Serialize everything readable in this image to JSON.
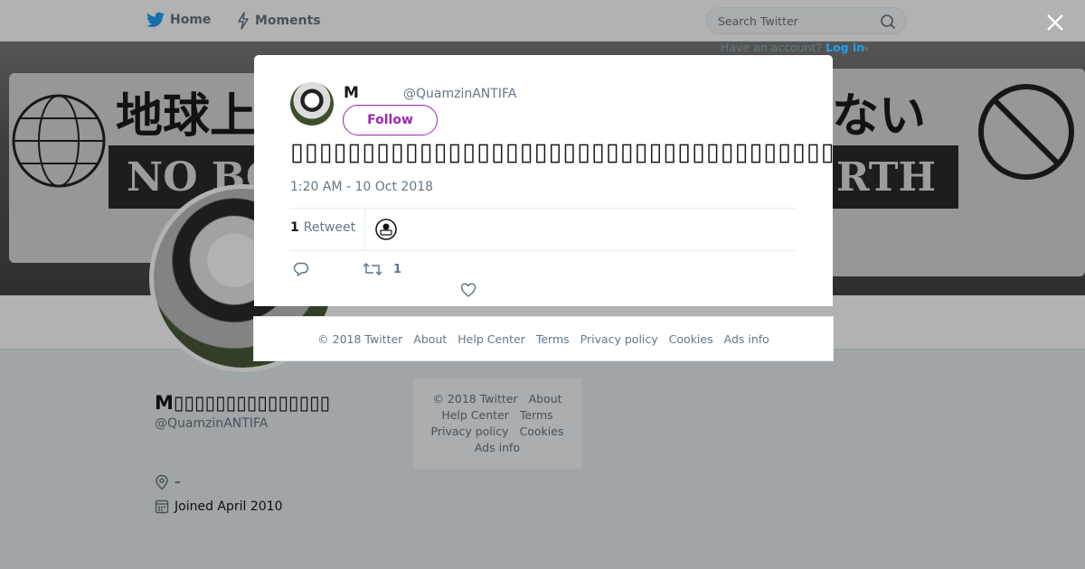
{
  "topbar": {
    "home_label": "Home",
    "moments_label": "Moments",
    "search_placeholder": "Search Twitter",
    "have_account": "Have an account?",
    "login_label": "Log in",
    "login_caret": "▾"
  },
  "banner": {
    "left_text": "地球上",
    "left_sub": "NO BO",
    "right_text": "ない",
    "right_sub": "RTH"
  },
  "profile": {
    "name": "M▯▯▯▯▯▯▯▯▯▯▯▯▯▯▯",
    "handle": "@QuamzinANTIFA",
    "location": "–",
    "joined": "Joined April 2010"
  },
  "side_footer": {
    "copyright": "© 2018 Twitter",
    "links": [
      "About",
      "Help Center",
      "Terms",
      "Privacy policy",
      "Cookies",
      "Ads info"
    ]
  },
  "tweet": {
    "author_name": "M",
    "author_handle": "@QuamzinANTIFA",
    "follow_label": "Follow",
    "text": "▯▯▯▯▯▯▯▯▯▯▯▯▯▯▯▯▯▯▯▯▯▯▯▯▯▯▯▯▯▯▯▯▯▯▯▯▯▯▯▯▯▯▯▯▯▯▯▯",
    "timestamp": "1:20 AM - 10 Oct 2018",
    "retweet_count": "1",
    "retweet_label": "Retweet",
    "action_retweet_count": "1"
  },
  "footer": {
    "copyright": "© 2018 Twitter",
    "links": [
      "About",
      "Help Center",
      "Terms",
      "Privacy policy",
      "Cookies",
      "Ads info"
    ]
  },
  "colors": {
    "accent": "#1da1f2",
    "follow": "#9c27b0"
  },
  "icons": [
    "twitter-bird-icon",
    "lightning-icon",
    "search-icon",
    "close-icon",
    "location-icon",
    "calendar-icon",
    "reply-icon",
    "retweet-icon",
    "heart-icon"
  ]
}
